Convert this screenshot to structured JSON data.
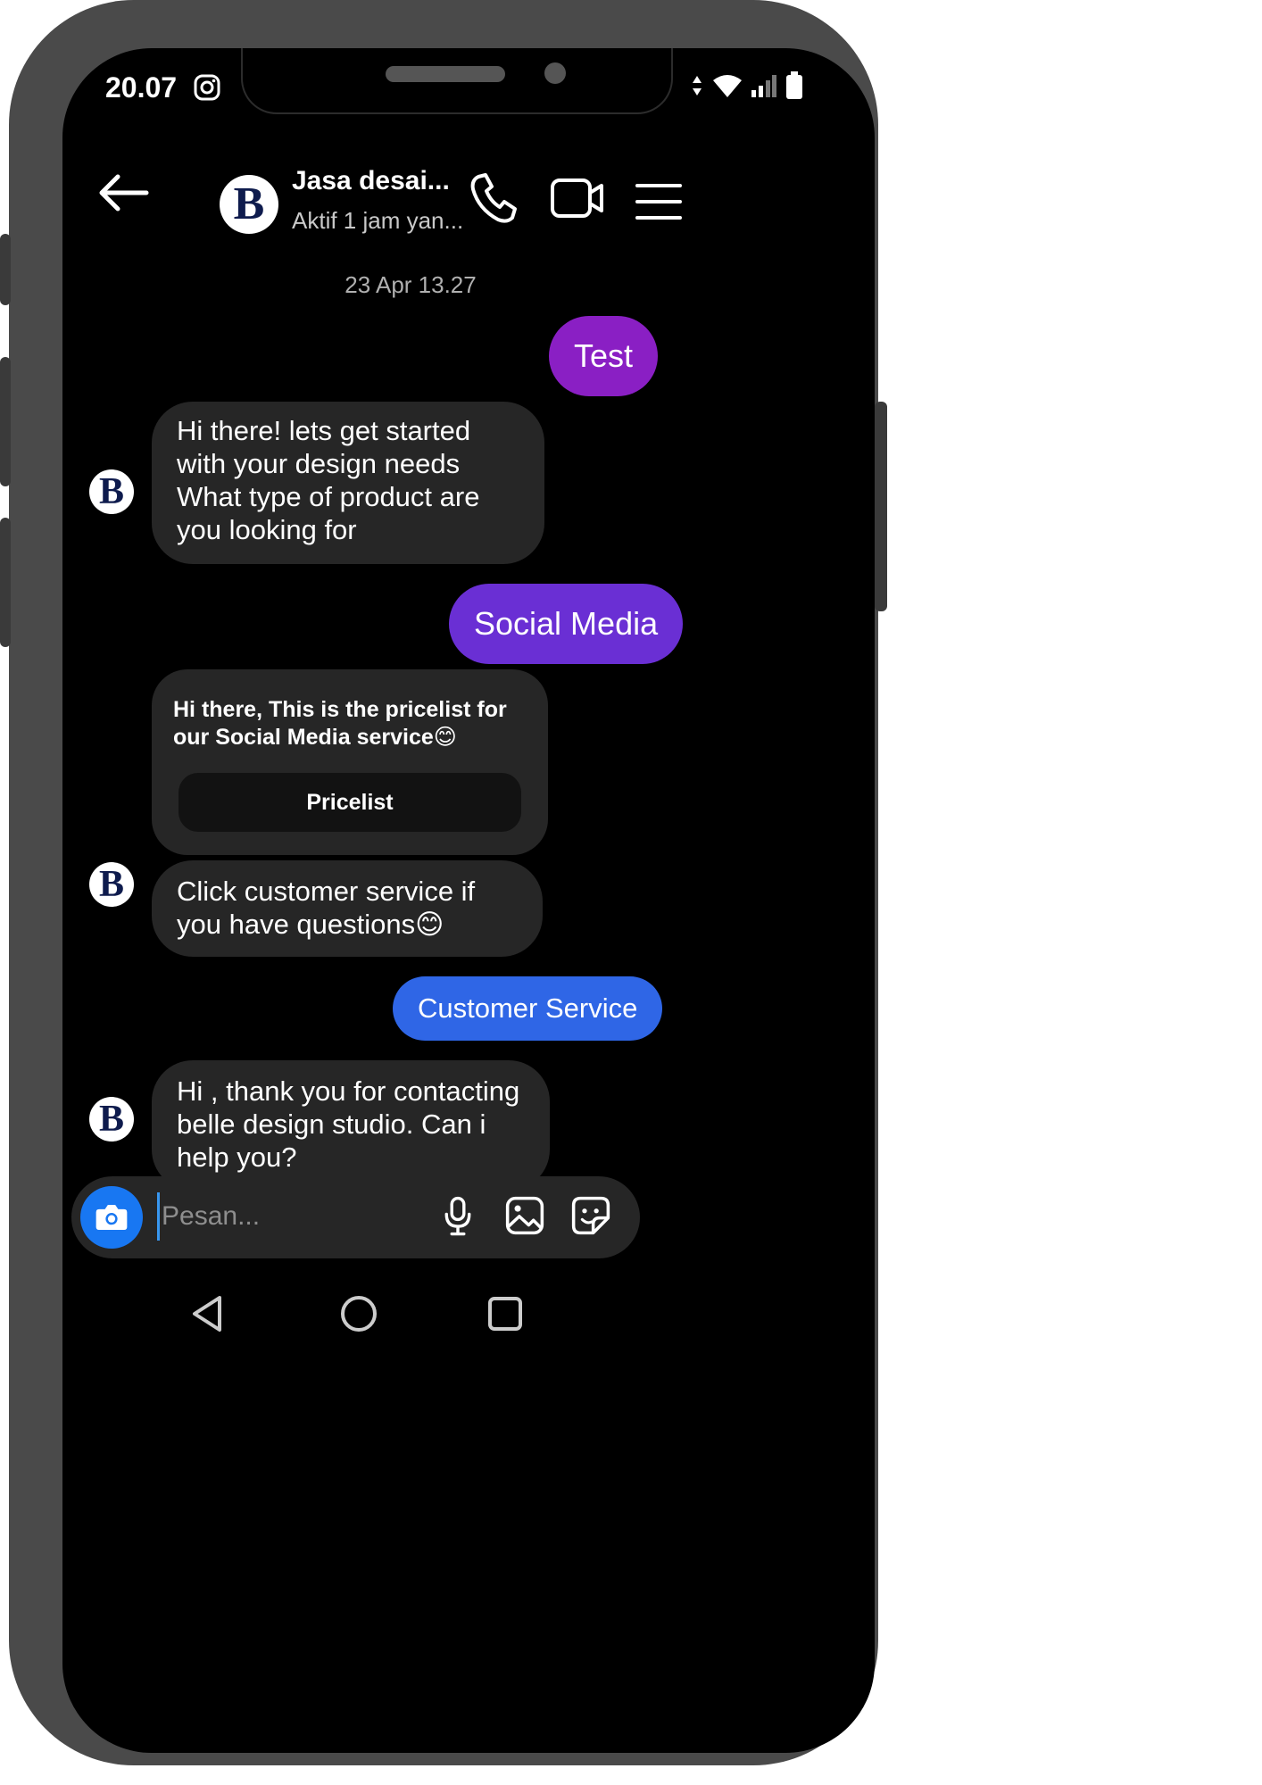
{
  "status_bar": {
    "time": "20.07"
  },
  "header": {
    "avatar_letter": "B",
    "contact_name": "Jasa desai...",
    "contact_status": "Aktif 1 jam yan..."
  },
  "timestamp": "23 Apr 13.27",
  "messages": [
    {
      "from": "me",
      "text": "Test",
      "color": "#8a1fc4"
    },
    {
      "from": "them",
      "text": "Hi  there! lets get started with your design needs\nWhat type of product are you looking for"
    },
    {
      "from": "me",
      "text": "Social Media",
      "color": "#6a2fd4"
    },
    {
      "from": "them",
      "text": "Hi there, This is the pricelist for our Social Media service😊",
      "button": "Pricelist"
    },
    {
      "from": "them",
      "text": "Click customer service  if you have questions😊"
    },
    {
      "from": "me",
      "text": "Customer Service",
      "color": "#2f66e6"
    },
    {
      "from": "them",
      "text": "Hi , thank you for contacting belle design studio. Can i help you?"
    }
  ],
  "composer": {
    "placeholder": "Pesan..."
  },
  "colors": {
    "background": "#000000",
    "incoming_bubble": "#262626",
    "camera_button": "#1877f2"
  }
}
